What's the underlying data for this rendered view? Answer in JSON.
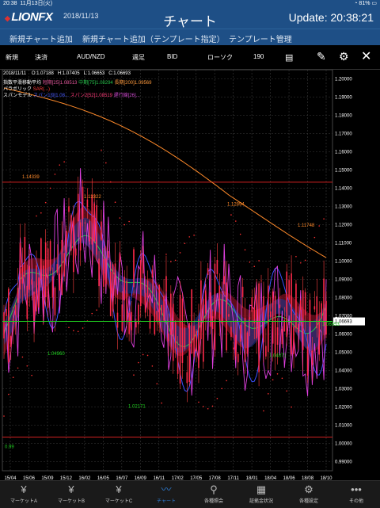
{
  "status": {
    "time": "20:38",
    "date": "11月13日(火)",
    "battery": "81%"
  },
  "header": {
    "logo": "LIONFX",
    "date": "2018/11/13",
    "title": "チャート",
    "update": "Update: 20:38:21"
  },
  "menu": [
    "新規チャート追加",
    "新規チャート追加（テンプレート指定）",
    "テンプレート管理"
  ],
  "toolbar": {
    "new": "新規",
    "settle": "決済",
    "pair": "AUD/NZD",
    "period": "週足",
    "bid": "BID",
    "candle": "ローソク",
    "count": "190"
  },
  "ohlc": {
    "date": "2018/11/11",
    "open": "O:1.07188",
    "high": "H:1.07405",
    "low": "L:1.06653",
    "close": "C:1.06693"
  },
  "indicators": {
    "ma_label": "指数平滑移動平均",
    "ma_short": "短期[25]1.08513",
    "ma_mid": "中期[75]1.08294",
    "ma_long": "長期[200]1.09569",
    "parabolic_label": "パラボリック",
    "parabolic_val": "SAR(...)",
    "span_label": "スパンモデル",
    "span_a": "スパン1[9]1.08...",
    "span_b": "スパン2[52]1.08519",
    "lag": "遅行線[26]..."
  },
  "chart_data": {
    "type": "line",
    "ylim": [
      0.985,
      1.205
    ],
    "yticks": [
      "1.20000",
      "1.19000",
      "1.18000",
      "1.17000",
      "1.16000",
      "1.15000",
      "1.14000",
      "1.13000",
      "1.12000",
      "1.11000",
      "1.10000",
      "1.09000",
      "1.08000",
      "1.07000",
      "1.06000",
      "1.05000",
      "1.04000",
      "1.03000",
      "1.02000",
      "1.01000",
      "1.00000",
      "0.99000"
    ],
    "xticks": [
      "15/04",
      "15/06",
      "15/09",
      "15/12",
      "16/02",
      "16/05",
      "16/07",
      "16/09",
      "16/11",
      "17/02",
      "17/05",
      "17/08",
      "17/11",
      "18/01",
      "18/04",
      "18/06",
      "18/08",
      "18/10"
    ],
    "current_price": "1.06693",
    "hlines": [
      {
        "value": 1.1433
      },
      {
        "value": 1.0035
      }
    ],
    "annotations": [
      "1.14339",
      "1.13322",
      "1.12894",
      "1.11748",
      "1.04960",
      "1.04871",
      "1.06653",
      "1.02171",
      "0.99"
    ]
  },
  "tabs": [
    "マーケットA",
    "マーケットB",
    "マーケットC",
    "チャート",
    "各種照会",
    "証拠金状況",
    "各種設定",
    "その他"
  ]
}
